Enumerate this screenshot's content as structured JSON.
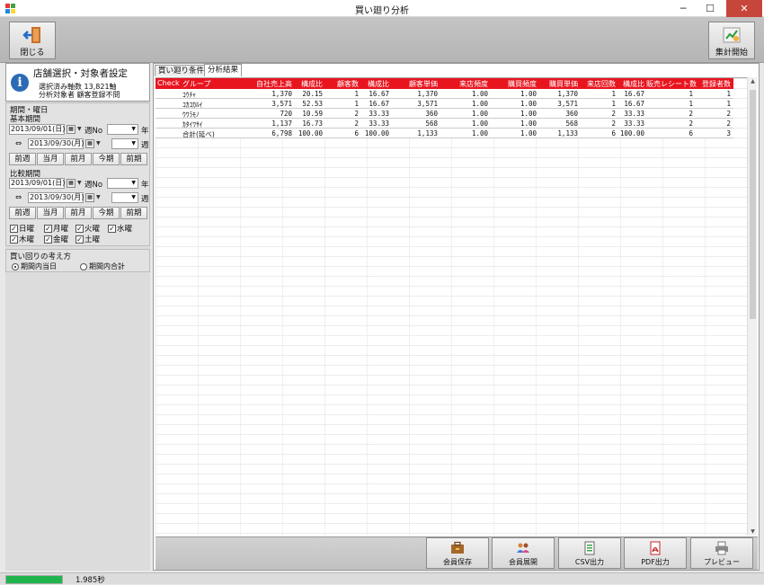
{
  "window": {
    "title": "買い廻り分析",
    "minimize": "─",
    "maximize": "☐",
    "close": "✕"
  },
  "toolbar": {
    "close_label": "閉じる",
    "aggregate_label": "集計開始"
  },
  "info": {
    "title": "店舗選択・対象者設定",
    "line1": "選択済み軸数 13,821軸",
    "line2": "分析対象者 顧客登録不問"
  },
  "period": {
    "header": "期間・曜日",
    "base_label": "基本期間",
    "base_from": "2013/09/01(日)",
    "base_to": "2013/09/30(月)",
    "week_label": "週No",
    "year_unit": "年",
    "week_unit": "週",
    "range_symbol": "⇔",
    "compare_label": "比較期間",
    "compare_from": "2013/09/01(日)",
    "compare_to": "2013/09/30(月)",
    "buttons": [
      "前週",
      "当月",
      "前月",
      "今期",
      "前期"
    ],
    "weekdays": [
      "日曜",
      "月曜",
      "火曜",
      "水曜",
      "木曜",
      "金曜",
      "土曜"
    ]
  },
  "method": {
    "header": "買い回りの考え方",
    "option1": "期間内当日",
    "option2": "期間内合計"
  },
  "tabs": [
    "買い廻り条件",
    "分析結果"
  ],
  "table": {
    "headers": [
      "Check",
      "グループ",
      "自社売上高",
      "構成比",
      "顧客数",
      "構成比",
      "顧客単価",
      "来店頻度",
      "購買頻度",
      "購買単価",
      "来店回数",
      "構成比",
      "販売レシート数",
      "登録者数"
    ],
    "rows": [
      [
        "",
        "ｺｳﾁｬ",
        "1,370",
        "20.15",
        "1",
        "16.67",
        "1,370",
        "1.00",
        "1.00",
        "1,370",
        "1",
        "16.67",
        "1",
        "1"
      ],
      [
        "",
        "ｺｶｺｶﾙｲ",
        "3,571",
        "52.53",
        "1",
        "16.67",
        "3,571",
        "1.00",
        "1.00",
        "3,571",
        "1",
        "16.67",
        "1",
        "1"
      ],
      [
        "",
        "ｳﾜﾗﾓﾉ",
        "720",
        "10.59",
        "2",
        "33.33",
        "360",
        "1.00",
        "1.00",
        "360",
        "2",
        "33.33",
        "2",
        "2"
      ],
      [
        "",
        "ｶﾀｲﾜｻｲ",
        "1,137",
        "16.73",
        "2",
        "33.33",
        "568",
        "1.00",
        "1.00",
        "568",
        "2",
        "33.33",
        "2",
        "2"
      ],
      [
        "",
        "合計(延べ)",
        "6,798",
        "100.00",
        "6",
        "100.00",
        "1,133",
        "1.00",
        "1.00",
        "1,133",
        "6",
        "100.00",
        "6",
        "3"
      ]
    ]
  },
  "bottom_buttons": [
    "会員保存",
    "会員展開",
    "CSV出力",
    "PDF出力",
    "プレビュー"
  ],
  "status": {
    "progress": 1.0,
    "time": "1.985秒"
  }
}
